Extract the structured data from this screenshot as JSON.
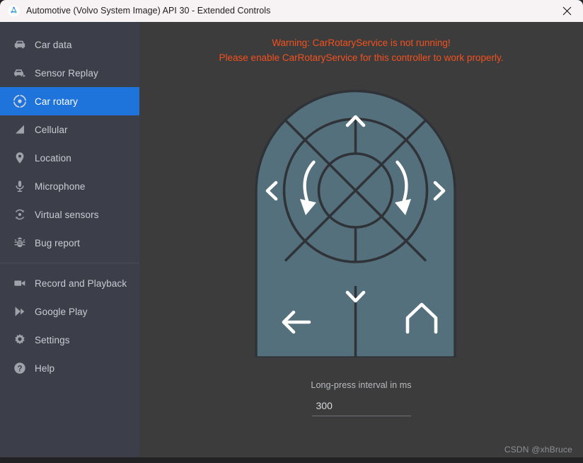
{
  "window": {
    "title": "Automotive (Volvo System Image) API 30 - Extended Controls",
    "app_icon": "android-studio-icon",
    "close_icon": "close-icon",
    "background_color": "#3c3c3c",
    "titlebar_color": "#f7f2f4"
  },
  "sidebar": {
    "background_color": "#3c3f4a",
    "selected_color": "#1f74db",
    "items": [
      {
        "label": "Car data",
        "icon": "car-icon",
        "selected": false
      },
      {
        "label": "Sensor Replay",
        "icon": "car-replay-icon",
        "selected": false
      },
      {
        "label": "Car rotary",
        "icon": "rotary-knob-icon",
        "selected": true
      },
      {
        "label": "Cellular",
        "icon": "signal-bars-icon",
        "selected": false
      },
      {
        "label": "Location",
        "icon": "map-pin-icon",
        "selected": false
      },
      {
        "label": "Microphone",
        "icon": "microphone-icon",
        "selected": false
      },
      {
        "label": "Virtual sensors",
        "icon": "virtual-sensors-icon",
        "selected": false
      },
      {
        "label": "Bug report",
        "icon": "bug-icon",
        "selected": false
      }
    ],
    "items_after_divider": [
      {
        "label": "Record and Playback",
        "icon": "video-camera-icon",
        "selected": false
      },
      {
        "label": "Google Play",
        "icon": "google-play-icon",
        "selected": false
      },
      {
        "label": "Settings",
        "icon": "gear-icon",
        "selected": false
      },
      {
        "label": "Help",
        "icon": "help-circle-icon",
        "selected": false
      }
    ]
  },
  "main": {
    "warning_line1": "Warning: CarRotaryService is not running!",
    "warning_line2": "Please enable CarRotaryService for this controller to work properly.",
    "warning_color": "#f4511e",
    "rotary": {
      "fill_color": "#54707c",
      "stroke_color": "#2f3338",
      "glyph_color": "#ffffff",
      "buttons": [
        {
          "name": "up",
          "icon": "chevron-up-icon"
        },
        {
          "name": "down",
          "icon": "chevron-down-icon"
        },
        {
          "name": "left",
          "icon": "chevron-left-icon"
        },
        {
          "name": "right",
          "icon": "chevron-right-icon"
        },
        {
          "name": "rotate-counter",
          "icon": "rotate-ccw-arrow-icon"
        },
        {
          "name": "rotate-clock",
          "icon": "rotate-cw-arrow-icon"
        },
        {
          "name": "center",
          "icon": "center-knob"
        },
        {
          "name": "back",
          "icon": "back-arrow-icon"
        },
        {
          "name": "home",
          "icon": "home-icon"
        }
      ]
    },
    "interval": {
      "label": "Long-press interval in ms",
      "value": "300",
      "placeholder": "300"
    },
    "watermark": "CSDN @xhBruce"
  }
}
